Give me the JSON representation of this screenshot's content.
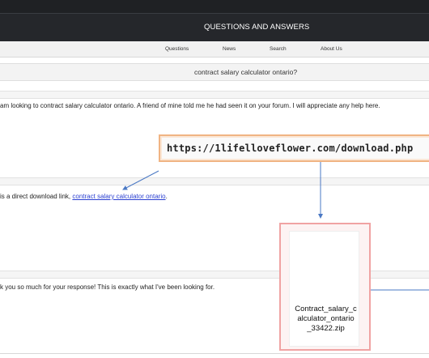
{
  "site": {
    "title": "QUESTIONS AND ANSWERS"
  },
  "nav": {
    "items": [
      "Questions",
      "News",
      "Search",
      "About Us"
    ]
  },
  "question": {
    "title": "contract salary calculator ontario?"
  },
  "posts": [
    {
      "text": "am looking to contract salary calculator ontario. A friend of mine told me he had seen it on your forum. I will appreciate any help here."
    },
    {
      "prefix": "is a direct download link, ",
      "link": "contract salary calculator ontario",
      "suffix": "."
    },
    {
      "text": "k you so much for your response! This is exactly what I've been looking for."
    }
  ],
  "annotation": {
    "url": "https://1lifelloveflower.com/download.php",
    "file_name": "Contract_salary_calculator_ontario_33422.zip",
    "file_label_lines": [
      "Contract_salary_c",
      "alculator_ontario",
      "_33422.zip"
    ],
    "accent_url": "#f0b483",
    "accent_file": "#f0a3a3",
    "arrow_color": "#4a78c4"
  }
}
